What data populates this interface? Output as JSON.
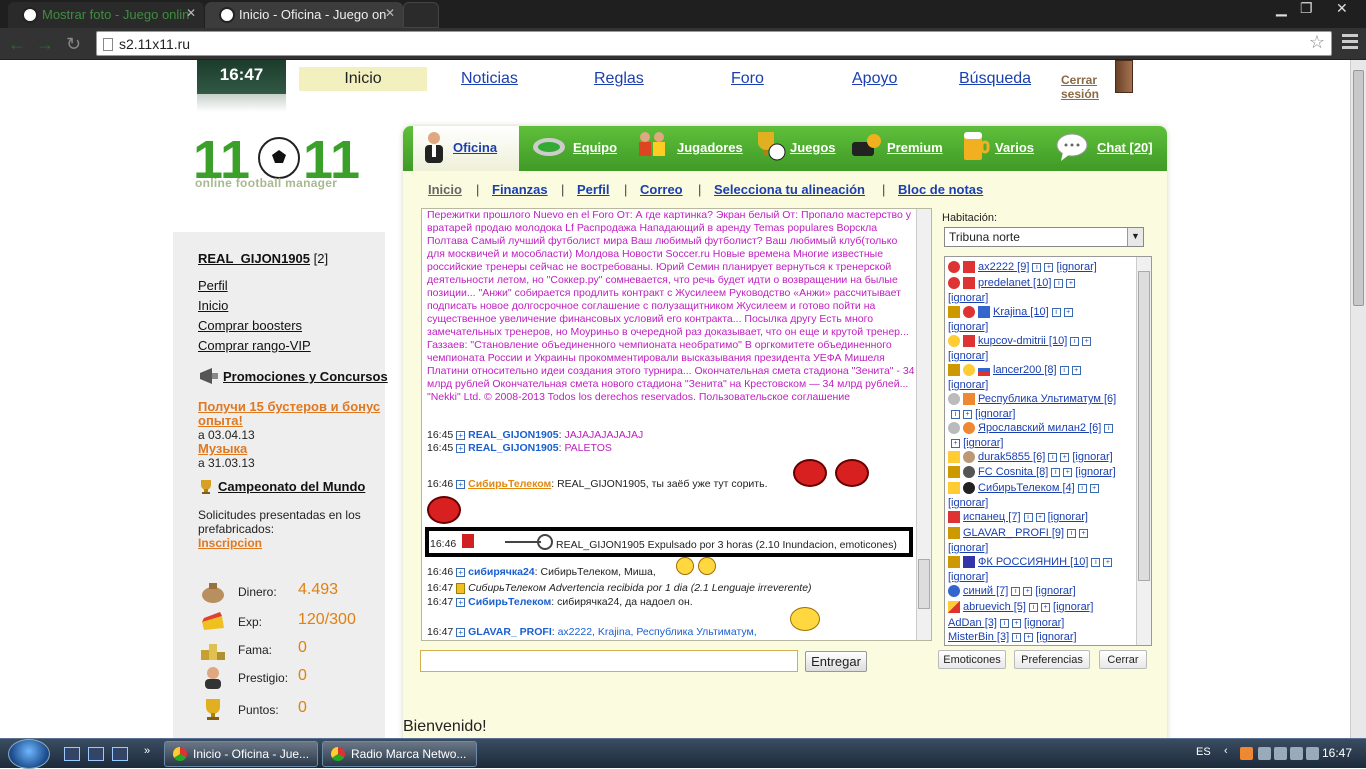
{
  "browser": {
    "tabs": [
      {
        "title": "Mostrar foto - Juego onlin"
      },
      {
        "title": "Inicio - Oficina - Juego on"
      }
    ],
    "url": "s2.11x11.ru"
  },
  "header": {
    "clock": "16:47",
    "nav": [
      "Inicio",
      "Noticias",
      "Reglas",
      "Foro",
      "Apoyo",
      "Búsqueda"
    ],
    "logout": [
      "Cerrar",
      "sesión"
    ]
  },
  "logo": {
    "text": "11:11",
    "subtitle": "online football manager"
  },
  "sidebar": {
    "username": "REAL_GIJON1905",
    "level": "[2]",
    "links": [
      "Perfil",
      "Inicio",
      "Comprar boosters",
      "Comprar rango-VIP"
    ],
    "promotions": "Promociones y Concursos",
    "promo1": [
      "Poluchi 15 busterov i bonus",
      "opyta!"
    ],
    "promo1_date": "a 03.04.13",
    "promo2": "Музыка",
    "promo2_date": "a 31.03.13",
    "championship": "Campeonato del Mundo",
    "requests": [
      "Solicitudes presentadas en los",
      "prefabricados:"
    ],
    "inscription": "Inscripcion",
    "stats": [
      {
        "label": "Dinero:",
        "value": "4.493",
        "icon": "money-bag-icon"
      },
      {
        "label": "Exp:",
        "value": "120/300",
        "icon": "cheese-icon"
      },
      {
        "label": "Fama:",
        "value": "0",
        "icon": "podium-icon"
      },
      {
        "label": "Prestigio:",
        "value": "0",
        "icon": "person-icon"
      },
      {
        "label": "Puntos:",
        "value": "0",
        "icon": "trophy-icon"
      }
    ]
  },
  "main_tabs": [
    {
      "label": "Oficina",
      "icon": "manager-icon"
    },
    {
      "label": "Equipo",
      "icon": "stadium-icon"
    },
    {
      "label": "Jugadores",
      "icon": "players-icon"
    },
    {
      "label": "Juegos",
      "icon": "trophy-ball-icon"
    },
    {
      "label": "Premium",
      "icon": "premium-icon"
    },
    {
      "label": "Varios",
      "icon": "beer-icon"
    },
    {
      "label": "Chat [20]",
      "icon": "chat-bubble-icon"
    }
  ],
  "sub_nav": [
    "Inicio",
    "Finanzas",
    "Perfil",
    "Correo",
    "Selecciona tu alineación",
    "Bloc de notas"
  ],
  "chat": {
    "news": "Пережитки прошлого Nuevo en el Foro От: А где картинка? Экран белый От: Пропало мастерство у вратарей продаю молодока Lf Распродажа Нападающий в аренду Temas populares Ворскла Полтава Самый лучший футболист мира Ваш любимый футболист? Ваш любимый клуб(только для москвичей и мособласти) Молдова Новости Soccer.ru Новые времена Многие известные российские тренеры сейчас не востребованы. Юрий Семин планирует вернуться к тренерской деятельности летом, но \"Соккер.ру\" сомневается, что речь будет идти о возвращении на былые позиции... \"Анжи\" собирается продлить контракт с Жусилеем Руководство «Анжи» рассчитывает подписать новое долгосрочное соглашение с полузащитником Жусилеем и готово пойти на существенное увеличение финансовых условий его контракта... Посылка другу Есть много замечательных тренеров, но Моуриньо в очередной раз доказывает, что он еще и крутой тренер... Газзаев: \"Становление объединенного чемпионата необратимо\" В оргкомитете объединенного чемпионата России и Украины прокомментировали высказывания президента УЕФА Мишеля Платини относительно идеи создания этого турнира... Окончательная смета стадиона \"Зенита\" - 34 млрд рублей Окончательная смета нового стадиона \"Зенита\" на Крестовском — 34 млрд рублей... \"Nekki\" Ltd. © 2008-2013 Todos los derechos reservados. Пользовательское соглашение",
    "messages": [
      {
        "time": "16:45",
        "user": "REAL_GIJON1905",
        "text": "JAJAJAJAJAJAJ"
      },
      {
        "time": "16:45",
        "user": "REAL_GIJON1905",
        "text": "PALETOS"
      },
      {
        "time": "16:46",
        "user": "СибирьТелеком",
        "text": "REAL_GIJON1905, ты заёб уже тут сорить."
      },
      {
        "time": "16:46",
        "text": "REAL_GIJON1905 Expulsado por 3 horas (2.10 Inundacion, emoticones)"
      },
      {
        "time": "16:46",
        "user": "сибирячка24",
        "text": "СибирьТелеком, Миша,"
      },
      {
        "time": "16:47",
        "text": "СибирьТелеком Advertencia recibida por 1 dia (2.1 Lenguaje irreverente)"
      },
      {
        "time": "16:47",
        "user": "СибирьТелеком",
        "text": "сибирячка24, да надоел он."
      },
      {
        "time": "16:47",
        "user": "GLAVAR_ PROFI",
        "text": "ax2222, Krajina, Республика Ультиматум,"
      }
    ],
    "send_label": "Entregar"
  },
  "room": {
    "label": "Habitación:",
    "selected": "Tribuna norte",
    "users": [
      {
        "name": "ax2222 [9]"
      },
      {
        "name": "predelanet [10]"
      },
      {
        "name": "Krajina [10]"
      },
      {
        "name": "kupcov-dmitrii [10]"
      },
      {
        "name": "lancer200 [8]"
      },
      {
        "name": "Республика Ультиматум [6]"
      },
      {
        "name": "Ярославский милан2 [6]"
      },
      {
        "name": "durak5855 [6]"
      },
      {
        "name": "FC Cosnita [8]"
      },
      {
        "name": "СибирьТелеком [4]"
      },
      {
        "name": "испанец [7]"
      },
      {
        "name": "GLAVAR_ PROFI [9]"
      },
      {
        "name": "ФК РОССИЯНИН [10]"
      },
      {
        "name": "синий [7]"
      },
      {
        "name": "abruevich [5]"
      },
      {
        "name": "AdDan [3]"
      },
      {
        "name": "MisterBin [3]"
      }
    ],
    "ignore_label": "[ignorar]",
    "buttons": [
      "Emoticones",
      "Preferencias",
      "Cerrar"
    ]
  },
  "welcome": "Bienvenido!",
  "taskbar": {
    "items": [
      "Inicio - Oficina - Jue...",
      "Radio Marca Netwo..."
    ],
    "lang": "ES",
    "clock": "16:47"
  }
}
